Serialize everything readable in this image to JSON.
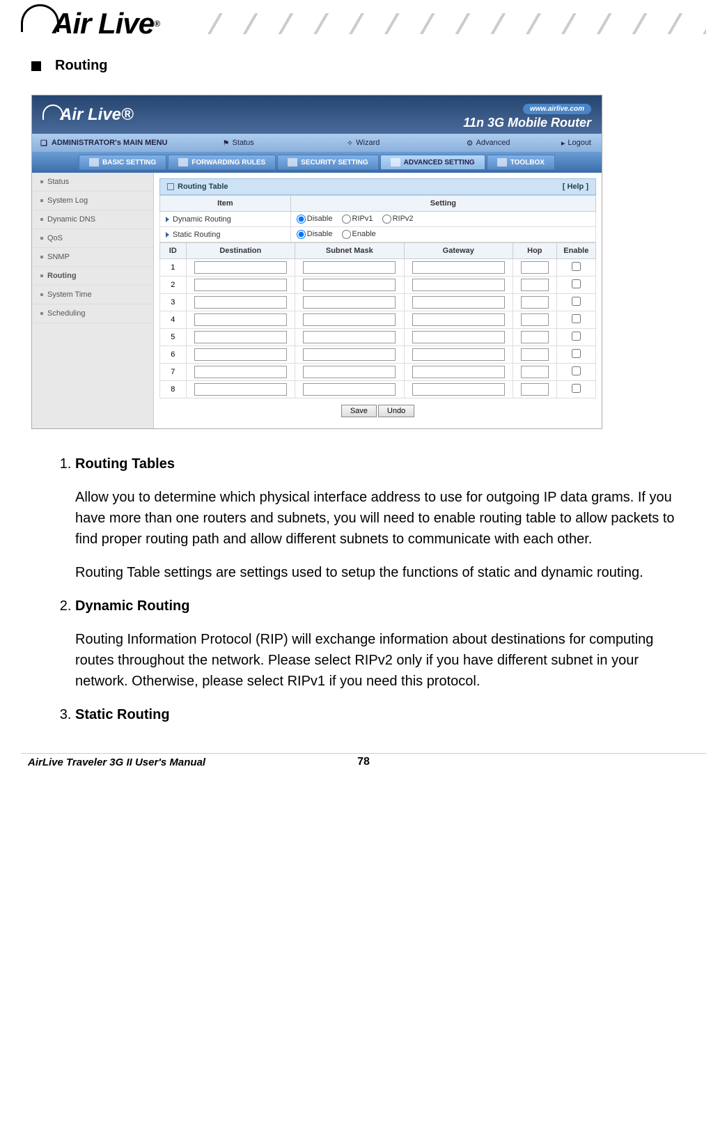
{
  "header": {
    "logo_text": "Air Live",
    "reg": "®"
  },
  "section": {
    "title": "Routing"
  },
  "screenshot": {
    "banner": {
      "logo": "Air Live",
      "url": "www.airlive.com",
      "tagline": "11n 3G Mobile Router"
    },
    "menu1": {
      "title": "ADMINISTRATOR's MAIN MENU",
      "items": [
        "Status",
        "Wizard",
        "Advanced"
      ],
      "logout": "Logout"
    },
    "tabs": [
      "BASIC SETTING",
      "FORWARDING RULES",
      "SECURITY SETTING",
      "ADVANCED SETTING",
      "TOOLBOX"
    ],
    "sidebar": [
      "Status",
      "System Log",
      "Dynamic DNS",
      "QoS",
      "SNMP",
      "Routing",
      "System Time",
      "Scheduling"
    ],
    "panel": {
      "title": "Routing Table",
      "help": "[ Help ]"
    },
    "cfg_headers": [
      "Item",
      "Setting"
    ],
    "dynamic": {
      "label": "Dynamic Routing",
      "options": [
        "Disable",
        "RIPv1",
        "RIPv2"
      ],
      "selected": "Disable"
    },
    "static": {
      "label": "Static Routing",
      "options": [
        "Disable",
        "Enable"
      ],
      "selected": "Disable"
    },
    "route_headers": [
      "ID",
      "Destination",
      "Subnet Mask",
      "Gateway",
      "Hop",
      "Enable"
    ],
    "route_ids": [
      "1",
      "2",
      "3",
      "4",
      "5",
      "6",
      "7",
      "8"
    ],
    "buttons": {
      "save": "Save",
      "undo": "Undo"
    }
  },
  "doc": {
    "items": [
      {
        "title": "Routing Tables",
        "paras": [
          "Allow you to determine which physical interface address to use for outgoing IP data grams. If you have more than one routers and subnets, you will need to enable routing table to allow packets to find proper routing path and allow different subnets to communicate with each other.",
          "Routing Table settings are settings used to setup the functions of static and dynamic routing."
        ]
      },
      {
        "title": "Dynamic Routing",
        "paras": [
          "Routing Information Protocol (RIP) will exchange information about destinations for computing routes throughout the network. Please select RIPv2 only if you have different subnet in your network. Otherwise, please select RIPv1 if you need this protocol."
        ]
      },
      {
        "title": "Static Routing",
        "paras": []
      }
    ]
  },
  "footer": {
    "manual": "AirLive Traveler 3G II User's Manual",
    "page": "78"
  }
}
